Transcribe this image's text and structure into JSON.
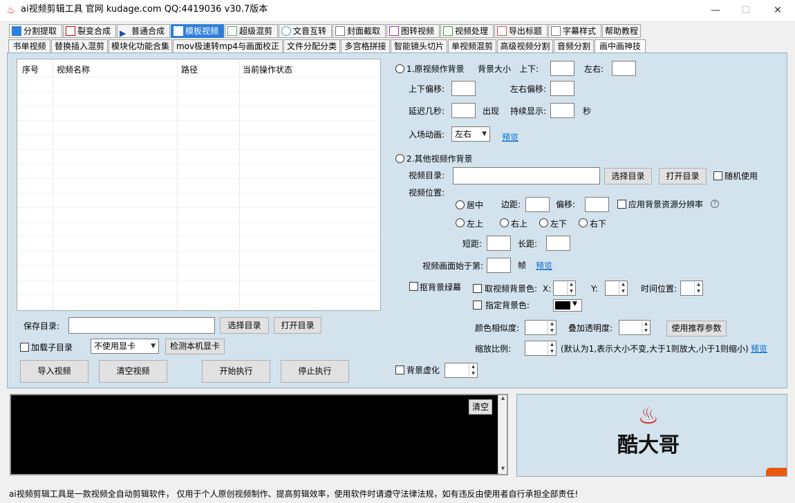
{
  "window": {
    "title": "ai视频剪辑工具 官网 kudage.com QQ:4419036   v30.7版本",
    "min": "—",
    "max": "☐",
    "close": "✕"
  },
  "main_tabs": [
    "分割提取",
    "裂变合成",
    "普通合成",
    "模板视频",
    "超级混剪",
    "文音互转",
    "封面截取",
    "图转视频",
    "视频处理",
    "导出标题",
    "字幕样式",
    "帮助教程"
  ],
  "sub_tabs": [
    "书单视频",
    "替换插入混剪",
    "模块化功能合集",
    "mov极速转mp4与画面校正",
    "文件分配分类",
    "多宫格拼接",
    "智能镜头切片",
    "单视频混剪",
    "高级视频分割",
    "音频分割",
    "画中画神技"
  ],
  "table": {
    "headers": [
      "序号",
      "视频名称",
      "路径",
      "当前操作状态"
    ]
  },
  "left": {
    "save_dir_label": "保存目录:",
    "choose_dir": "选择目录",
    "open_dir": "打开目录",
    "subdir_label": "加载子目录",
    "gpu_select": "不使用显卡",
    "detect_gpu": "检测本机显卡",
    "import_video": "导入视频",
    "clear_video": "清空视频",
    "start": "开始执行",
    "stop": "停止执行"
  },
  "right": {
    "opt1": "1.原视频作背景",
    "bg_size": "背景大小",
    "ud": "上下:",
    "lr": "左右:",
    "ud_offset": "上下偏移:",
    "lr_offset": "左右偏移:",
    "delay": "延迟几秒:",
    "appear": "出现",
    "duration": "持续显示:",
    "sec": "秒",
    "enter_anim": "入场动画:",
    "anim_value": "左右",
    "preview": "预览",
    "opt2": "2.其他视频作背景",
    "video_dir": "视频目录:",
    "choose_dir": "选择目录",
    "open_dir": "打开目录",
    "random_use": "随机使用",
    "video_pos": "视频位置:",
    "center": "居中",
    "margin": "边距:",
    "offset": "偏移:",
    "apply_res": "应用背景资源分辨率",
    "help_icon": "?",
    "top_left": "左上",
    "top_right": "右上",
    "bottom_left": "左下",
    "bottom_right": "右下",
    "short_margin": "短距:",
    "long_margin": "长距:",
    "start_frame": "视频画面始于第:",
    "frame": "帧",
    "chroma": "抠背景绿幕",
    "pick_color": "取视频背景色:",
    "x": "X:",
    "y": "Y:",
    "time_pos": "时间位置:",
    "set_color": "指定背景色:",
    "similarity": "颜色相似度:",
    "overlay_alpha": "叠加透明度:",
    "recommend": "使用推荐参数",
    "scale": "缩放比例:",
    "scale_hint": "(默认为1,表示大小不变,大于1则放大,小于1则缩小)",
    "blur": "背景虚化"
  },
  "console": {
    "clear": "清空"
  },
  "logo": {
    "text": "酷大哥",
    "symbol": "♨"
  },
  "status": "ai视频剪辑工具是一款视频全自动剪辑软件， 仅用于个人原创视频制作、提高剪辑效率，使用软件时请遵守法律法规，如有违反由使用者自行承担全部责任!",
  "colors": {
    "accent": "#2f7fd8",
    "logo_red": "#d01a12",
    "panel": "#d3e3ee"
  }
}
